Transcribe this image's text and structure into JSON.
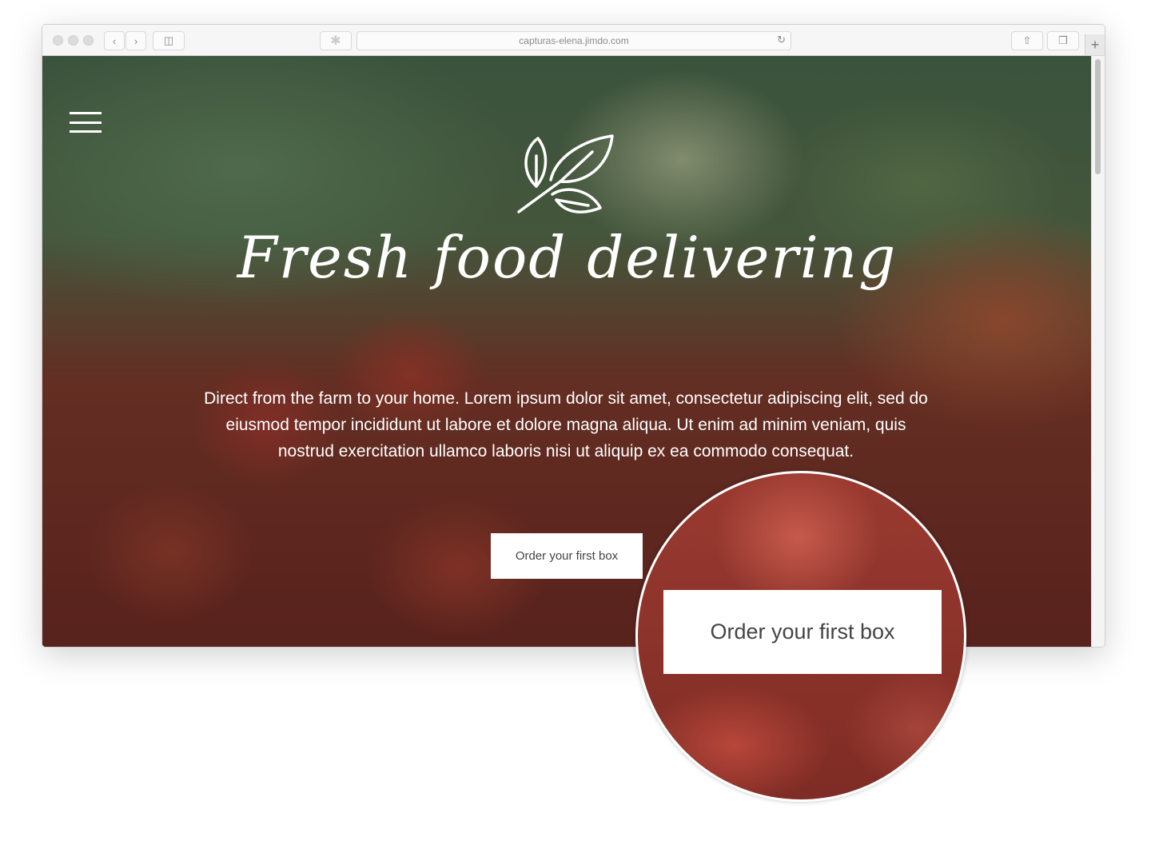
{
  "browser": {
    "url": "capturas-elena.jimdo.com",
    "icons": [
      "back-icon",
      "forward-icon",
      "sidebar-icon",
      "extension-icon",
      "reload-icon",
      "share-icon",
      "tabs-icon",
      "new-tab-icon"
    ]
  },
  "hero": {
    "title": "Fresh food delivering",
    "description": "Direct from the farm to your home. Lorem ipsum dolor sit amet, consectetur adipiscing elit, sed do eiusmod tempor incididunt ut labore et dolore magna aliqua. Ut enim ad minim veniam, quis nostrud exercitation ullamco laboris nisi ut aliquip ex ea commodo consequat.",
    "cta_label": "Order your first box"
  },
  "magnifier": {
    "cta_label": "Order your first box"
  }
}
